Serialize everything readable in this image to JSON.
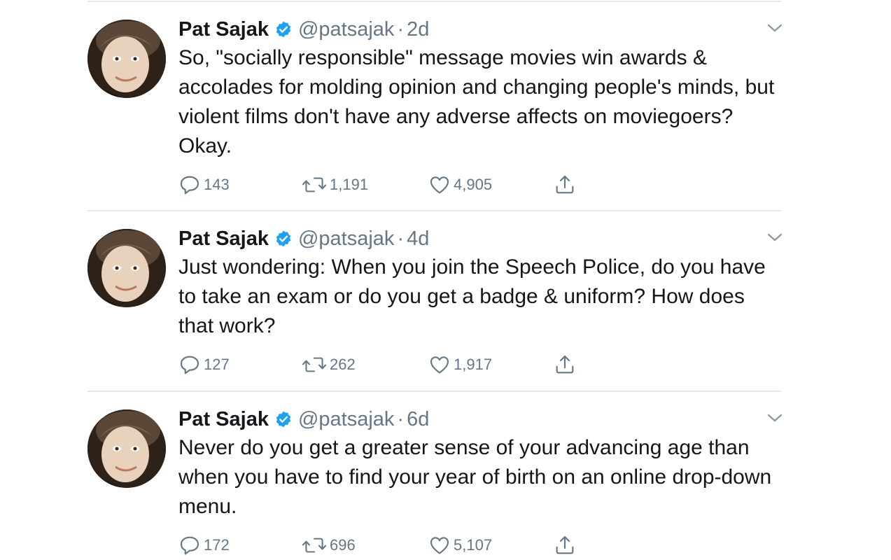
{
  "colors": {
    "text": "#14171a",
    "secondary": "#657786",
    "verified": "#1da1f2",
    "divider": "#e1e8ed"
  },
  "tweets": [
    {
      "name": "Pat Sajak",
      "handle": "@patsajak",
      "separator": "·",
      "time": "2d",
      "text": "So, \"socially responsible\" message movies win awards & accolades for molding opinion and changing people's minds, but violent films don't have any adverse affects on moviegoers? Okay.",
      "replies": "143",
      "retweets": "1,191",
      "likes": "4,905"
    },
    {
      "name": "Pat Sajak",
      "handle": "@patsajak",
      "separator": "·",
      "time": "4d",
      "text": "Just wondering: When you join the Speech Police, do you have to take an exam or do you get a badge & uniform? How does that work?",
      "replies": "127",
      "retweets": "262",
      "likes": "1,917"
    },
    {
      "name": "Pat Sajak",
      "handle": "@patsajak",
      "separator": "·",
      "time": "6d",
      "text": "Never do you get a greater sense of your advancing age than when you have to find your year of birth on an online drop-down menu.",
      "replies": "172",
      "retweets": "696",
      "likes": "5,107"
    }
  ],
  "icons": {
    "verified": "verified-badge-icon",
    "reply": "reply-icon",
    "retweet": "retweet-icon",
    "like": "heart-icon",
    "share": "share-icon",
    "menu": "chevron-down-icon"
  }
}
